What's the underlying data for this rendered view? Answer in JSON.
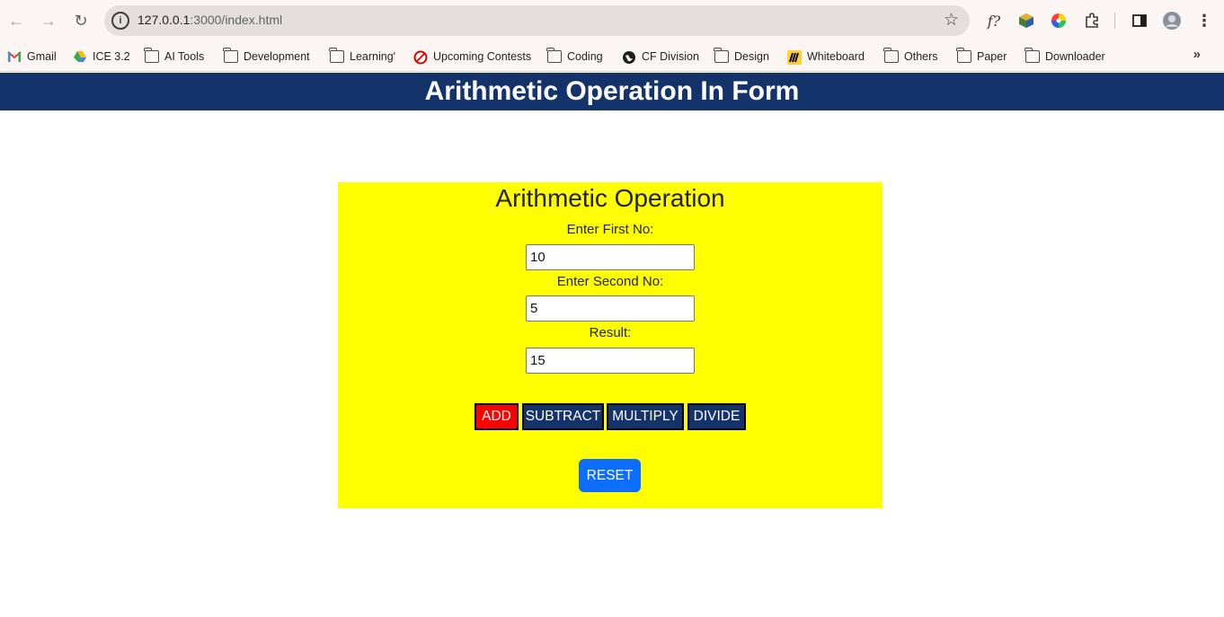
{
  "browser": {
    "url_host": "127.0.0.1",
    "url_path": ":3000/index.html",
    "extensions": [
      "function-icon",
      "cube-extension-icon",
      "color-wheel-icon",
      "puzzle-icon",
      "side-panel-icon",
      "avatar"
    ]
  },
  "bookmarks": [
    {
      "label": "Gmail",
      "icon": "gmail-icon"
    },
    {
      "label": "ICE 3.2",
      "icon": "drive-icon"
    },
    {
      "label": "AI Tools",
      "icon": "folder-icon"
    },
    {
      "label": "Development",
      "icon": "folder-icon"
    },
    {
      "label": "Learning'",
      "icon": "folder-icon"
    },
    {
      "label": "Upcoming Contests",
      "icon": "contest-icon"
    },
    {
      "label": "Coding",
      "icon": "folder-icon"
    },
    {
      "label": "CF Division",
      "icon": "globe-icon"
    },
    {
      "label": "Design",
      "icon": "folder-icon"
    },
    {
      "label": "Whiteboard",
      "icon": "miro-icon"
    },
    {
      "label": "Others",
      "icon": "folder-icon"
    },
    {
      "label": "Paper",
      "icon": "folder-icon"
    },
    {
      "label": "Downloader",
      "icon": "folder-icon"
    }
  ],
  "page": {
    "header_title": "Arithmetic Operation In Form",
    "card_title": "Arithmetic Operation",
    "first_label": "Enter First No:",
    "first_value": "10",
    "second_label": "Enter Second No:",
    "second_value": "5",
    "result_label": "Result:",
    "result_value": "15",
    "buttons": {
      "add": "ADD",
      "subtract": "SUBTRACT",
      "multiply": "MULTIPLY",
      "divide": "DIVIDE",
      "reset": "RESET"
    }
  },
  "colors": {
    "header_bg": "#14336b",
    "card_bg": "#ffff00",
    "add_bg": "#ff0000",
    "op_bg": "#14336b",
    "reset_bg": "#0d6efd"
  }
}
